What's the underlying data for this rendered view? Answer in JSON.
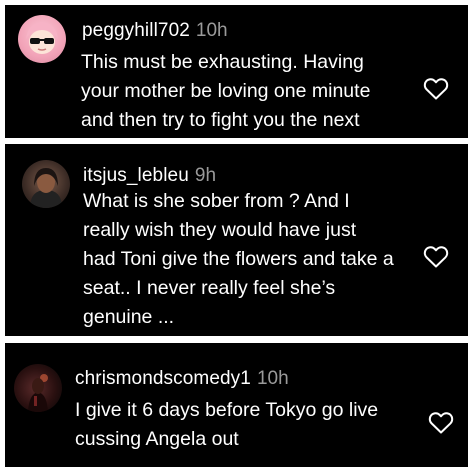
{
  "comments": [
    {
      "username": "peggyhill702",
      "time": "10h",
      "lines": [
        "This must be exhausting. Having",
        "your mother be loving one minute",
        "and then try to fight you the next"
      ],
      "avatar_icon": "cartoon-girl-sunglasses-avatar",
      "like_icon": "heart-outline-icon"
    },
    {
      "username": "itsjus_lebleu",
      "time": "9h",
      "lines": [
        "What is she sober from ? And I",
        "really wish they would have just",
        "had Toni give the flowers and take a",
        "seat.. I never really feel she’s",
        "genuine ..."
      ],
      "avatar_icon": "profile-photo-avatar",
      "like_icon": "heart-outline-icon"
    },
    {
      "username": "chrismondscomedy1",
      "time": "10h",
      "lines": [
        "I give it 6 days before Tokyo go live",
        "cussing Angela out"
      ],
      "avatar_icon": "profile-photo-avatar",
      "like_icon": "heart-outline-icon"
    }
  ],
  "colors": {
    "background": "#000000",
    "text": "#ffffff",
    "timestamp": "#9a9a9a",
    "page": "#ffffff"
  }
}
